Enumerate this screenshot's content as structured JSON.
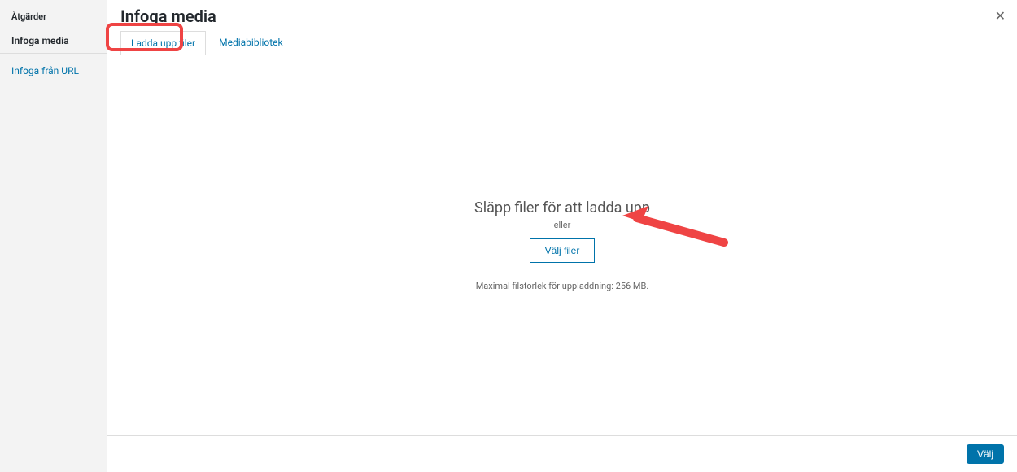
{
  "sidebar": {
    "heading": "Åtgärder",
    "items": [
      {
        "label": "Infoga media",
        "active": true
      },
      {
        "label": "Infoga från URL",
        "link": true
      }
    ]
  },
  "main": {
    "title": "Infoga media",
    "tabs": [
      {
        "label": "Ladda upp filer",
        "active": true
      },
      {
        "label": "Mediabibliotek",
        "active": false
      }
    ]
  },
  "upload": {
    "drop_title": "Släpp filer för att ladda upp",
    "drop_subtitle": "eller",
    "select_button": "Välj filer",
    "max_size": "Maximal filstorlek för uppladdning: 256 MB."
  },
  "footer": {
    "choose_button": "Välj"
  }
}
